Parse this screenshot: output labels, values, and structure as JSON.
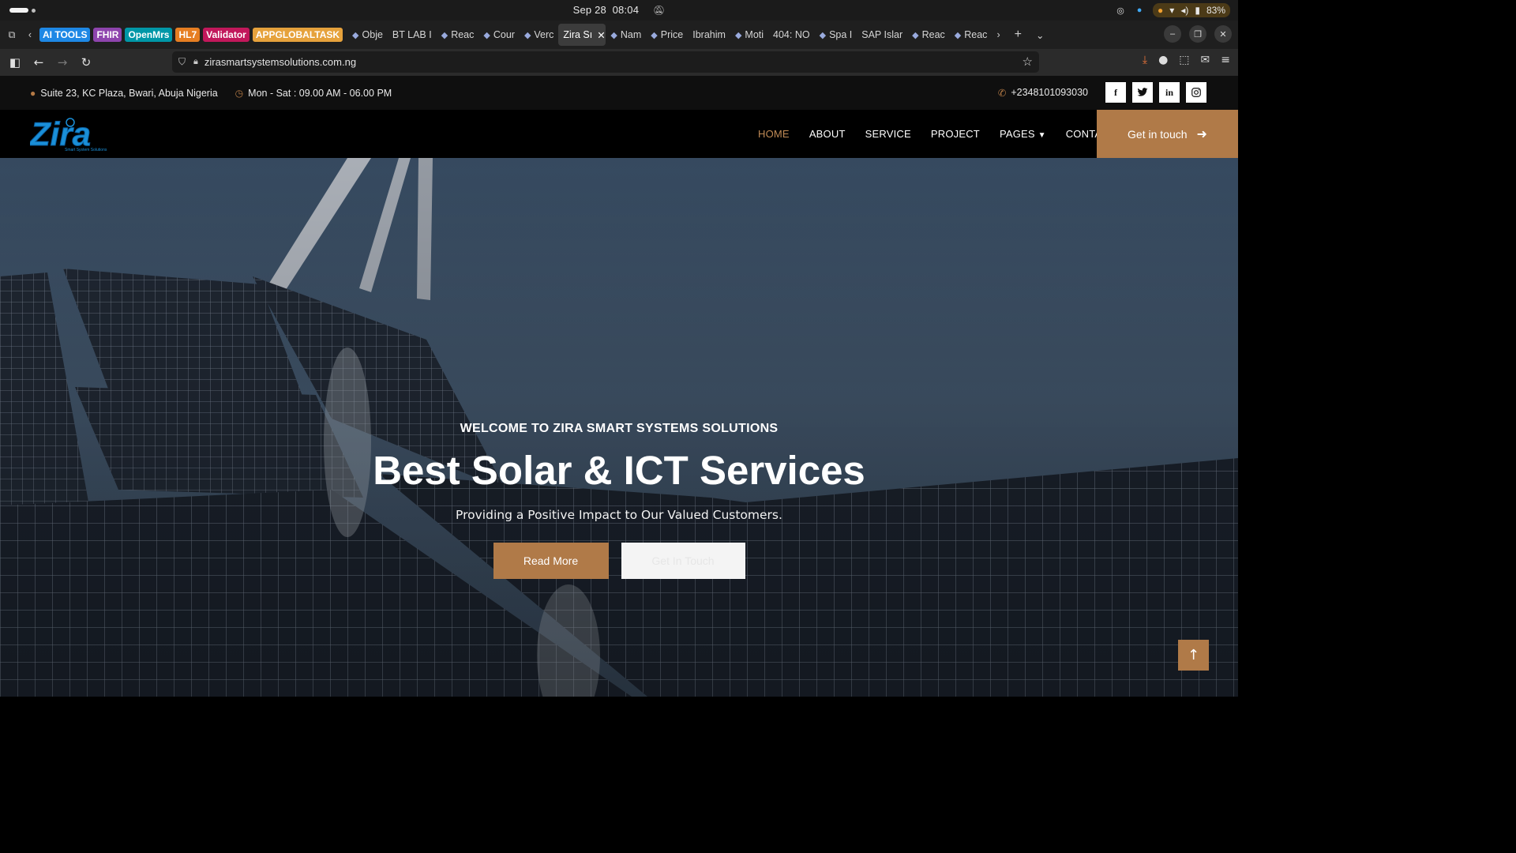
{
  "os": {
    "date": "Sep 28",
    "time": "08:04",
    "battery": "83%"
  },
  "tabs": {
    "pinned": [
      {
        "label": "AI TOOLS",
        "color": "#1e88e5"
      },
      {
        "label": "FHIR",
        "color": "#8e44ad"
      },
      {
        "label": "OpenMrs",
        "color": "#0097a7"
      },
      {
        "label": "HL7",
        "color": "#e67e22"
      },
      {
        "label": "Validator",
        "color": "#c2185b"
      },
      {
        "label": "APPGLOBALTASK",
        "color": "#e6a23c"
      }
    ],
    "items": [
      {
        "label": "Obje",
        "icon": "grid-icon"
      },
      {
        "label": "BT LAB I",
        "icon": ""
      },
      {
        "label": "Reac",
        "icon": "react-icon"
      },
      {
        "label": "Cour",
        "icon": "course-icon"
      },
      {
        "label": "Verc",
        "icon": "vercel-icon"
      },
      {
        "label": "Zira Sı",
        "icon": "",
        "active": true
      },
      {
        "label": "Nam",
        "icon": "globe-icon"
      },
      {
        "label": "Price",
        "icon": "price-icon"
      },
      {
        "label": "Ibrahim",
        "icon": ""
      },
      {
        "label": "Moti",
        "icon": "vercel-icon"
      },
      {
        "label": "404: NO",
        "icon": ""
      },
      {
        "label": "Spa I",
        "icon": "spa-icon"
      },
      {
        "label": "SAP Islar",
        "icon": ""
      },
      {
        "label": "Reac",
        "icon": "react-icon"
      },
      {
        "label": "Reac",
        "icon": "react-icon"
      }
    ]
  },
  "address": {
    "url": "zirasmartsystemsolutions.com.ng"
  },
  "site": {
    "top_info": {
      "address": "Suite 23, KC Plaza, Bwari, Abuja Nigeria",
      "hours": "Mon - Sat : 09.00 AM - 06.00 PM",
      "phone": "+2348101093030",
      "social": [
        "f",
        "t",
        "in",
        "ig"
      ]
    },
    "logo": {
      "name": "Zira",
      "tagline": "Smart System Solutions"
    },
    "nav": {
      "home": "HOME",
      "about": "ABOUT",
      "service": "SERVICE",
      "project": "PROJECT",
      "pages": "PAGES",
      "contact": "CONTACT",
      "cta": "Get in touch"
    },
    "hero": {
      "welcome": "WELCOME TO ZIRA SMART SYSTEMS SOLUTIONS",
      "headline": "Best Solar & ICT Services",
      "subline": "Providing a Positive Impact to Our Valued Customers.",
      "btn_primary": "Read More",
      "btn_secondary": "Get In Touch"
    }
  }
}
